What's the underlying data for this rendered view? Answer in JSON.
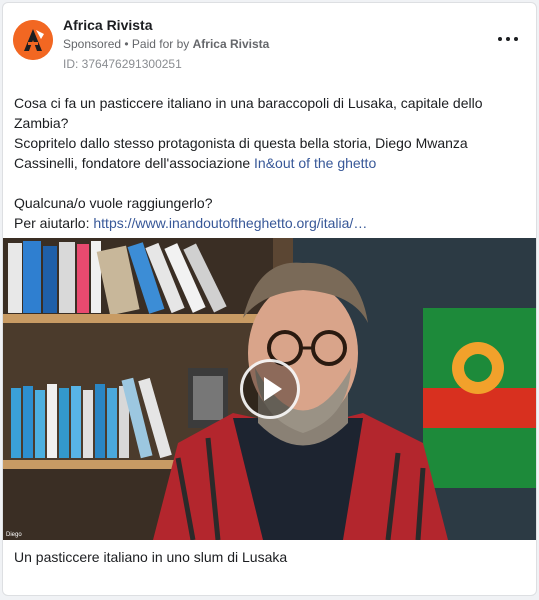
{
  "header": {
    "page_name": "Africa Rivista",
    "sponsored": "Sponsored",
    "separator": " • ",
    "paid_prefix": "Paid for by ",
    "paid_by": "Africa Rivista",
    "ad_id": "ID: 376476291300251"
  },
  "post": {
    "line1": "Cosa ci fa un pasticcere italiano in una baraccopoli di Lusaka, capitale dello Zambia?",
    "line2_text": "Scopritelo dallo stesso protagonista di questa bella storia, Diego Mwanza Cassinelli, fondatore dell'associazione ",
    "line2_link": "In&out of the ghetto",
    "line3": "Qualcuna/o vuole raggiungerlo?",
    "line4_text": "Per aiutarlo: ",
    "line4_link": "https://www.inandoutoftheghetto.org/italia/…"
  },
  "media": {
    "corner_label": "Diego",
    "caption": "Un pasticcere italiano in uno slum di Lusaka"
  },
  "colors": {
    "brand": "#f26722",
    "link": "#385898",
    "text": "#1c1e21",
    "muted": "#65676b"
  },
  "icons": {
    "avatar": "africa-rivista-logo-icon",
    "more": "more-options-icon",
    "play": "play-icon"
  }
}
